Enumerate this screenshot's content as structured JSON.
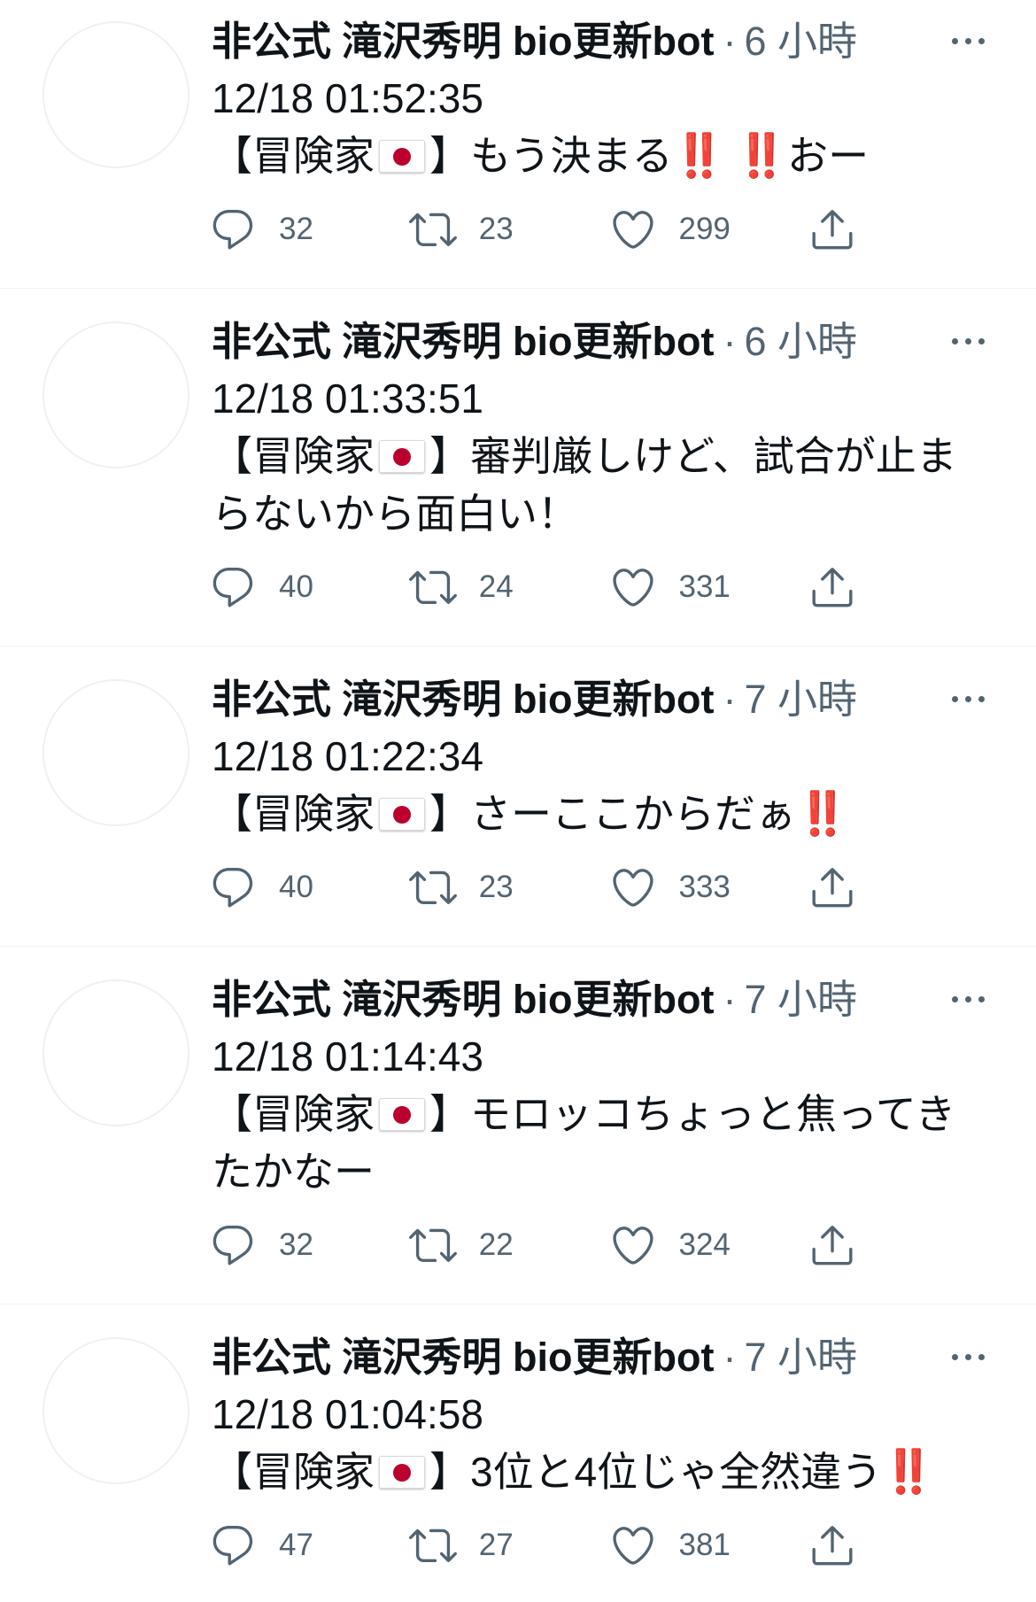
{
  "colors": {
    "text": "#0f1419",
    "secondary": "#536471",
    "divider": "#eff3f4",
    "emphasis_red": "#e0242f",
    "flag_red": "#bc002d"
  },
  "icons": {
    "reply": "reply-icon",
    "retweet": "retweet-icon",
    "like": "like-icon",
    "share": "share-icon",
    "more": "more-options-icon",
    "flag": "japan-flag-icon"
  },
  "tweets": [
    {
      "author": "非公式 滝沢秀明 bio更新bot",
      "separator": "·",
      "time": "6 小時",
      "date_line": "12/18 01:52:35",
      "tag": {
        "open": "【冒険家",
        "icon": "japan-flag-icon",
        "close": "】"
      },
      "segments": [
        "もう決まる",
        "‼️",
        "‼️",
        "おー"
      ],
      "replies": 32,
      "retweets": 23,
      "likes": 299
    },
    {
      "author": "非公式 滝沢秀明 bio更新bot",
      "separator": "·",
      "time": "6 小時",
      "date_line": "12/18 01:33:51",
      "tag": {
        "open": "【冒険家",
        "icon": "japan-flag-icon",
        "close": "】"
      },
      "segments": [
        "審判厳しけど、試合が止ま"
      ],
      "continuation": "らないから面白い！",
      "replies": 40,
      "retweets": 24,
      "likes": 331
    },
    {
      "author": "非公式 滝沢秀明 bio更新bot",
      "separator": "·",
      "time": "7 小時",
      "date_line": "12/18 01:22:34",
      "tag": {
        "open": "【冒険家",
        "icon": "japan-flag-icon",
        "close": "】"
      },
      "segments": [
        "さーここからだぁ",
        "‼️"
      ],
      "replies": 40,
      "retweets": 23,
      "likes": 333
    },
    {
      "author": "非公式 滝沢秀明 bio更新bot",
      "separator": "·",
      "time": "7 小時",
      "date_line": "12/18 01:14:43",
      "tag": {
        "open": "【冒険家",
        "icon": "japan-flag-icon",
        "close": "】"
      },
      "segments": [
        "モロッコちょっと焦ってき"
      ],
      "continuation": "たかなー",
      "replies": 32,
      "retweets": 22,
      "likes": 324
    },
    {
      "author": "非公式 滝沢秀明 bio更新bot",
      "separator": "·",
      "time": "7 小時",
      "date_line": "12/18 01:04:58",
      "tag": {
        "open": "【冒険家",
        "icon": "japan-flag-icon",
        "close": "】"
      },
      "segments": [
        "3位と4位じゃ全然違う",
        "‼️"
      ],
      "replies": 47,
      "retweets": 27,
      "likes": 381
    }
  ]
}
